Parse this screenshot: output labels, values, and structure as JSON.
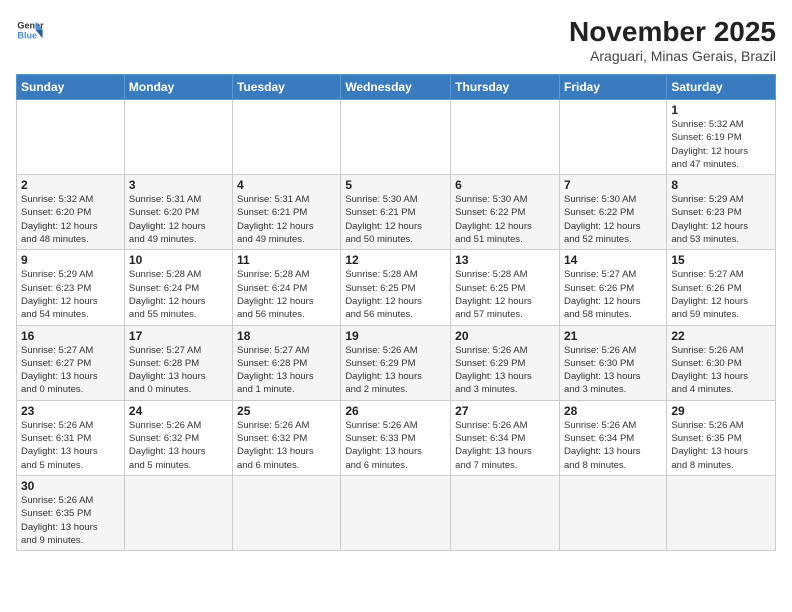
{
  "header": {
    "logo_general": "General",
    "logo_blue": "Blue",
    "month_title": "November 2025",
    "location": "Araguari, Minas Gerais, Brazil"
  },
  "weekdays": [
    "Sunday",
    "Monday",
    "Tuesday",
    "Wednesday",
    "Thursday",
    "Friday",
    "Saturday"
  ],
  "weeks": [
    [
      {
        "day": "",
        "info": ""
      },
      {
        "day": "",
        "info": ""
      },
      {
        "day": "",
        "info": ""
      },
      {
        "day": "",
        "info": ""
      },
      {
        "day": "",
        "info": ""
      },
      {
        "day": "",
        "info": ""
      },
      {
        "day": "1",
        "info": "Sunrise: 5:32 AM\nSunset: 6:19 PM\nDaylight: 12 hours\nand 47 minutes."
      }
    ],
    [
      {
        "day": "2",
        "info": "Sunrise: 5:32 AM\nSunset: 6:20 PM\nDaylight: 12 hours\nand 48 minutes."
      },
      {
        "day": "3",
        "info": "Sunrise: 5:31 AM\nSunset: 6:20 PM\nDaylight: 12 hours\nand 49 minutes."
      },
      {
        "day": "4",
        "info": "Sunrise: 5:31 AM\nSunset: 6:21 PM\nDaylight: 12 hours\nand 49 minutes."
      },
      {
        "day": "5",
        "info": "Sunrise: 5:30 AM\nSunset: 6:21 PM\nDaylight: 12 hours\nand 50 minutes."
      },
      {
        "day": "6",
        "info": "Sunrise: 5:30 AM\nSunset: 6:22 PM\nDaylight: 12 hours\nand 51 minutes."
      },
      {
        "day": "7",
        "info": "Sunrise: 5:30 AM\nSunset: 6:22 PM\nDaylight: 12 hours\nand 52 minutes."
      },
      {
        "day": "8",
        "info": "Sunrise: 5:29 AM\nSunset: 6:23 PM\nDaylight: 12 hours\nand 53 minutes."
      }
    ],
    [
      {
        "day": "9",
        "info": "Sunrise: 5:29 AM\nSunset: 6:23 PM\nDaylight: 12 hours\nand 54 minutes."
      },
      {
        "day": "10",
        "info": "Sunrise: 5:28 AM\nSunset: 6:24 PM\nDaylight: 12 hours\nand 55 minutes."
      },
      {
        "day": "11",
        "info": "Sunrise: 5:28 AM\nSunset: 6:24 PM\nDaylight: 12 hours\nand 56 minutes."
      },
      {
        "day": "12",
        "info": "Sunrise: 5:28 AM\nSunset: 6:25 PM\nDaylight: 12 hours\nand 56 minutes."
      },
      {
        "day": "13",
        "info": "Sunrise: 5:28 AM\nSunset: 6:25 PM\nDaylight: 12 hours\nand 57 minutes."
      },
      {
        "day": "14",
        "info": "Sunrise: 5:27 AM\nSunset: 6:26 PM\nDaylight: 12 hours\nand 58 minutes."
      },
      {
        "day": "15",
        "info": "Sunrise: 5:27 AM\nSunset: 6:26 PM\nDaylight: 12 hours\nand 59 minutes."
      }
    ],
    [
      {
        "day": "16",
        "info": "Sunrise: 5:27 AM\nSunset: 6:27 PM\nDaylight: 13 hours\nand 0 minutes."
      },
      {
        "day": "17",
        "info": "Sunrise: 5:27 AM\nSunset: 6:28 PM\nDaylight: 13 hours\nand 0 minutes."
      },
      {
        "day": "18",
        "info": "Sunrise: 5:27 AM\nSunset: 6:28 PM\nDaylight: 13 hours\nand 1 minute."
      },
      {
        "day": "19",
        "info": "Sunrise: 5:26 AM\nSunset: 6:29 PM\nDaylight: 13 hours\nand 2 minutes."
      },
      {
        "day": "20",
        "info": "Sunrise: 5:26 AM\nSunset: 6:29 PM\nDaylight: 13 hours\nand 3 minutes."
      },
      {
        "day": "21",
        "info": "Sunrise: 5:26 AM\nSunset: 6:30 PM\nDaylight: 13 hours\nand 3 minutes."
      },
      {
        "day": "22",
        "info": "Sunrise: 5:26 AM\nSunset: 6:30 PM\nDaylight: 13 hours\nand 4 minutes."
      }
    ],
    [
      {
        "day": "23",
        "info": "Sunrise: 5:26 AM\nSunset: 6:31 PM\nDaylight: 13 hours\nand 5 minutes."
      },
      {
        "day": "24",
        "info": "Sunrise: 5:26 AM\nSunset: 6:32 PM\nDaylight: 13 hours\nand 5 minutes."
      },
      {
        "day": "25",
        "info": "Sunrise: 5:26 AM\nSunset: 6:32 PM\nDaylight: 13 hours\nand 6 minutes."
      },
      {
        "day": "26",
        "info": "Sunrise: 5:26 AM\nSunset: 6:33 PM\nDaylight: 13 hours\nand 6 minutes."
      },
      {
        "day": "27",
        "info": "Sunrise: 5:26 AM\nSunset: 6:34 PM\nDaylight: 13 hours\nand 7 minutes."
      },
      {
        "day": "28",
        "info": "Sunrise: 5:26 AM\nSunset: 6:34 PM\nDaylight: 13 hours\nand 8 minutes."
      },
      {
        "day": "29",
        "info": "Sunrise: 5:26 AM\nSunset: 6:35 PM\nDaylight: 13 hours\nand 8 minutes."
      }
    ],
    [
      {
        "day": "30",
        "info": "Sunrise: 5:26 AM\nSunset: 6:35 PM\nDaylight: 13 hours\nand 9 minutes."
      },
      {
        "day": "",
        "info": ""
      },
      {
        "day": "",
        "info": ""
      },
      {
        "day": "",
        "info": ""
      },
      {
        "day": "",
        "info": ""
      },
      {
        "day": "",
        "info": ""
      },
      {
        "day": "",
        "info": ""
      }
    ]
  ]
}
